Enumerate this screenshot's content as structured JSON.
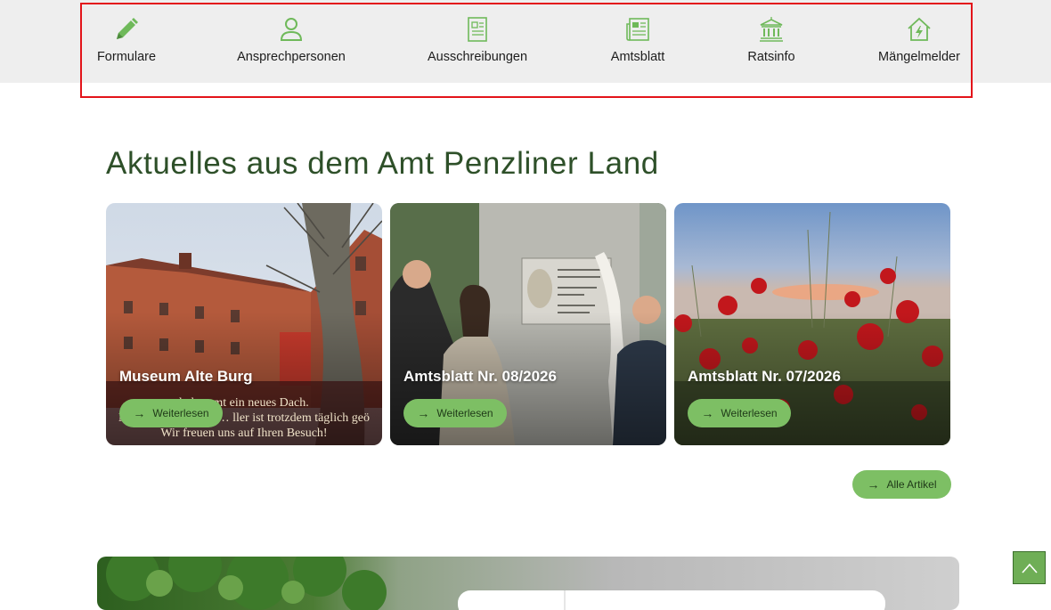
{
  "quicknav": {
    "items": [
      {
        "label": "Formulare",
        "icon": "pencil-icon"
      },
      {
        "label": "Ansprechpersonen",
        "icon": "person-icon"
      },
      {
        "label": "Ausschreibungen",
        "icon": "document-icon"
      },
      {
        "label": "Amtsblatt",
        "icon": "newspaper-icon"
      },
      {
        "label": "Ratsinfo",
        "icon": "town-hall-icon"
      },
      {
        "label": "Mängelmelder",
        "icon": "house-alert-icon"
      }
    ]
  },
  "news": {
    "title": "Aktuelles aus dem Amt Penzliner Land",
    "cards": [
      {
        "title": "Museum Alte Burg",
        "button": "Weiterlesen",
        "image_text": [
          "bekommt ein neues Dach.",
          "Museum Alte Burg … ller ist trotzdem täglich geö",
          "Wir freuen uns auf Ihren Besuch!"
        ]
      },
      {
        "title": "Amtsblatt Nr. 08/2026",
        "button": "Weiterlesen"
      },
      {
        "title": "Amtsblatt Nr. 07/2026",
        "button": "Weiterlesen"
      }
    ],
    "all_button": "Alle Artikel"
  },
  "colors": {
    "accent": "#7dbf64",
    "heading": "#2e5029",
    "icon": "#6fb95a"
  }
}
